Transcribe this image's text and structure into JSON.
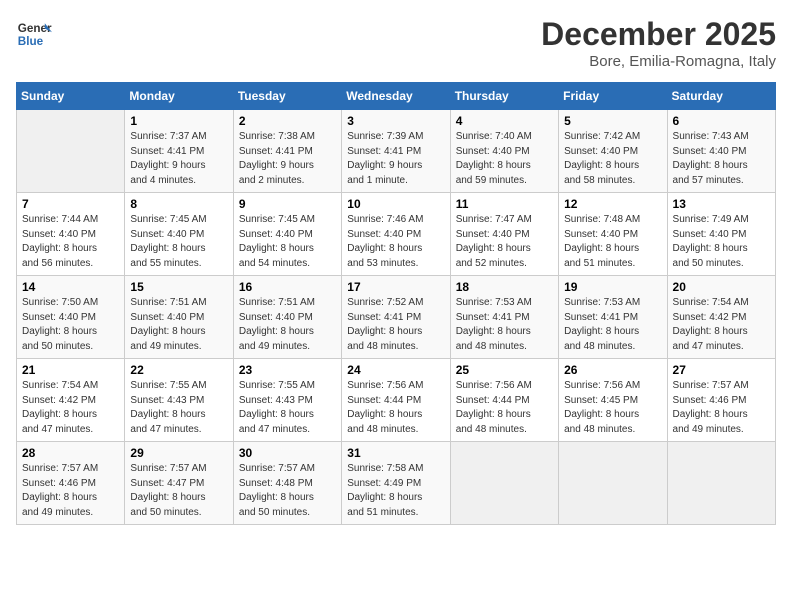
{
  "header": {
    "logo_line1": "General",
    "logo_line2": "Blue",
    "month_title": "December 2025",
    "subtitle": "Bore, Emilia-Romagna, Italy"
  },
  "weekdays": [
    "Sunday",
    "Monday",
    "Tuesday",
    "Wednesday",
    "Thursday",
    "Friday",
    "Saturday"
  ],
  "weeks": [
    [
      {
        "day": "",
        "info": ""
      },
      {
        "day": "1",
        "info": "Sunrise: 7:37 AM\nSunset: 4:41 PM\nDaylight: 9 hours\nand 4 minutes."
      },
      {
        "day": "2",
        "info": "Sunrise: 7:38 AM\nSunset: 4:41 PM\nDaylight: 9 hours\nand 2 minutes."
      },
      {
        "day": "3",
        "info": "Sunrise: 7:39 AM\nSunset: 4:41 PM\nDaylight: 9 hours\nand 1 minute."
      },
      {
        "day": "4",
        "info": "Sunrise: 7:40 AM\nSunset: 4:40 PM\nDaylight: 8 hours\nand 59 minutes."
      },
      {
        "day": "5",
        "info": "Sunrise: 7:42 AM\nSunset: 4:40 PM\nDaylight: 8 hours\nand 58 minutes."
      },
      {
        "day": "6",
        "info": "Sunrise: 7:43 AM\nSunset: 4:40 PM\nDaylight: 8 hours\nand 57 minutes."
      }
    ],
    [
      {
        "day": "7",
        "info": "Sunrise: 7:44 AM\nSunset: 4:40 PM\nDaylight: 8 hours\nand 56 minutes."
      },
      {
        "day": "8",
        "info": "Sunrise: 7:45 AM\nSunset: 4:40 PM\nDaylight: 8 hours\nand 55 minutes."
      },
      {
        "day": "9",
        "info": "Sunrise: 7:45 AM\nSunset: 4:40 PM\nDaylight: 8 hours\nand 54 minutes."
      },
      {
        "day": "10",
        "info": "Sunrise: 7:46 AM\nSunset: 4:40 PM\nDaylight: 8 hours\nand 53 minutes."
      },
      {
        "day": "11",
        "info": "Sunrise: 7:47 AM\nSunset: 4:40 PM\nDaylight: 8 hours\nand 52 minutes."
      },
      {
        "day": "12",
        "info": "Sunrise: 7:48 AM\nSunset: 4:40 PM\nDaylight: 8 hours\nand 51 minutes."
      },
      {
        "day": "13",
        "info": "Sunrise: 7:49 AM\nSunset: 4:40 PM\nDaylight: 8 hours\nand 50 minutes."
      }
    ],
    [
      {
        "day": "14",
        "info": "Sunrise: 7:50 AM\nSunset: 4:40 PM\nDaylight: 8 hours\nand 50 minutes."
      },
      {
        "day": "15",
        "info": "Sunrise: 7:51 AM\nSunset: 4:40 PM\nDaylight: 8 hours\nand 49 minutes."
      },
      {
        "day": "16",
        "info": "Sunrise: 7:51 AM\nSunset: 4:40 PM\nDaylight: 8 hours\nand 49 minutes."
      },
      {
        "day": "17",
        "info": "Sunrise: 7:52 AM\nSunset: 4:41 PM\nDaylight: 8 hours\nand 48 minutes."
      },
      {
        "day": "18",
        "info": "Sunrise: 7:53 AM\nSunset: 4:41 PM\nDaylight: 8 hours\nand 48 minutes."
      },
      {
        "day": "19",
        "info": "Sunrise: 7:53 AM\nSunset: 4:41 PM\nDaylight: 8 hours\nand 48 minutes."
      },
      {
        "day": "20",
        "info": "Sunrise: 7:54 AM\nSunset: 4:42 PM\nDaylight: 8 hours\nand 47 minutes."
      }
    ],
    [
      {
        "day": "21",
        "info": "Sunrise: 7:54 AM\nSunset: 4:42 PM\nDaylight: 8 hours\nand 47 minutes."
      },
      {
        "day": "22",
        "info": "Sunrise: 7:55 AM\nSunset: 4:43 PM\nDaylight: 8 hours\nand 47 minutes."
      },
      {
        "day": "23",
        "info": "Sunrise: 7:55 AM\nSunset: 4:43 PM\nDaylight: 8 hours\nand 47 minutes."
      },
      {
        "day": "24",
        "info": "Sunrise: 7:56 AM\nSunset: 4:44 PM\nDaylight: 8 hours\nand 48 minutes."
      },
      {
        "day": "25",
        "info": "Sunrise: 7:56 AM\nSunset: 4:44 PM\nDaylight: 8 hours\nand 48 minutes."
      },
      {
        "day": "26",
        "info": "Sunrise: 7:56 AM\nSunset: 4:45 PM\nDaylight: 8 hours\nand 48 minutes."
      },
      {
        "day": "27",
        "info": "Sunrise: 7:57 AM\nSunset: 4:46 PM\nDaylight: 8 hours\nand 49 minutes."
      }
    ],
    [
      {
        "day": "28",
        "info": "Sunrise: 7:57 AM\nSunset: 4:46 PM\nDaylight: 8 hours\nand 49 minutes."
      },
      {
        "day": "29",
        "info": "Sunrise: 7:57 AM\nSunset: 4:47 PM\nDaylight: 8 hours\nand 50 minutes."
      },
      {
        "day": "30",
        "info": "Sunrise: 7:57 AM\nSunset: 4:48 PM\nDaylight: 8 hours\nand 50 minutes."
      },
      {
        "day": "31",
        "info": "Sunrise: 7:58 AM\nSunset: 4:49 PM\nDaylight: 8 hours\nand 51 minutes."
      },
      {
        "day": "",
        "info": ""
      },
      {
        "day": "",
        "info": ""
      },
      {
        "day": "",
        "info": ""
      }
    ]
  ]
}
